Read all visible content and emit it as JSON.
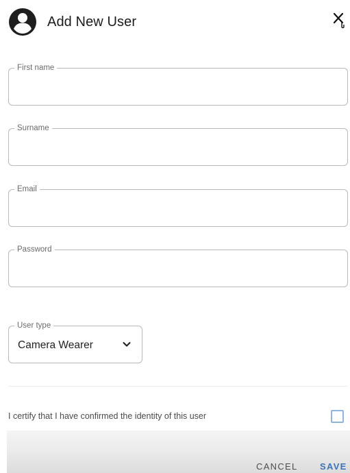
{
  "dialog": {
    "title": "Add New User",
    "avatar_icon": "account-circle-icon",
    "close_icon": "close-icon"
  },
  "form": {
    "first_name": {
      "label": "First name",
      "value": ""
    },
    "surname": {
      "label": "Surname",
      "value": ""
    },
    "email": {
      "label": "Email",
      "value": ""
    },
    "password": {
      "label": "Password",
      "value": ""
    },
    "user_type": {
      "label": "User type",
      "selected": "Camera Wearer",
      "icon": "chevron-down-icon"
    }
  },
  "certify": {
    "label": "I certify that I have confirmed the identity of this user",
    "checked": false
  },
  "actions": {
    "cancel_label": "CANCEL",
    "save_label": "SAVE"
  },
  "colors": {
    "primary": "#3b73b6",
    "checkbox_border": "#8fb4df",
    "field_border": "#b9b9b9"
  }
}
